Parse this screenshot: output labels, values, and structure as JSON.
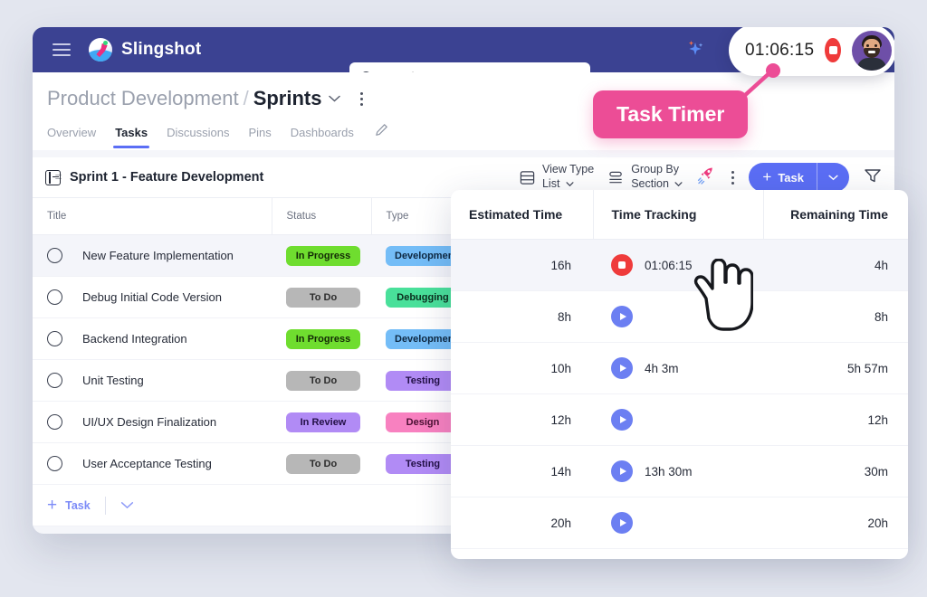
{
  "app": {
    "brand": "Slingshot",
    "menu_icon": "hamburger-icon",
    "logo_icon": "slingshot-rocket-logo"
  },
  "search": {
    "placeholder": "Search...",
    "value": "",
    "icon": "search-icon"
  },
  "topbar": {
    "ai_icon": "sparkles-icon",
    "notification_icon": "bell-icon",
    "timer_value": "01:06:15",
    "stop_icon": "stop-icon",
    "avatar": "user-avatar"
  },
  "callout": {
    "label": "Task Timer"
  },
  "breadcrumb": {
    "parent": "Product Development",
    "separator": "/",
    "current": "Sprints",
    "caret_icon": "chevron-down-icon",
    "more_icon": "kebab-menu-icon"
  },
  "tabs": [
    {
      "label": "Overview",
      "active": false
    },
    {
      "label": "Tasks",
      "active": true
    },
    {
      "label": "Discussions",
      "active": false
    },
    {
      "label": "Pins",
      "active": false
    },
    {
      "label": "Dashboards",
      "active": false
    }
  ],
  "tabs_edit_icon": "pencil-icon",
  "sprint": {
    "icon": "sprint-panel-icon",
    "title": "Sprint 1 - Feature Development"
  },
  "toolbar": {
    "view_type_label": "View Type",
    "view_type_value": "List",
    "view_type_icon": "list-view-icon",
    "group_by_label": "Group By",
    "group_by_value": "Section",
    "group_by_icon": "group-by-icon",
    "rocket_icon": "rocket-icon",
    "more_icon": "kebab-menu-icon",
    "add_task_label": "Task",
    "add_task_plus": "+",
    "add_task_caret_icon": "chevron-down-icon",
    "filter_icon": "filter-icon"
  },
  "task_table": {
    "columns": [
      "Title",
      "Status",
      "Type"
    ],
    "rows": [
      {
        "title": "New Feature Implementation",
        "status": "In Progress",
        "status_bg": "#6fdd2f",
        "status_fg": "#132a06",
        "type": "Development",
        "type_bg": "#74bdf7",
        "type_fg": "#0d2740",
        "highlight": true
      },
      {
        "title": "Debug Initial Code Version",
        "status": "To Do",
        "status_bg": "#b7b7b7",
        "status_fg": "#2c2c2c",
        "type": "Debugging",
        "type_bg": "#49e09a",
        "type_fg": "#0b2e1d",
        "highlight": false
      },
      {
        "title": "Backend Integration",
        "status": "In Progress",
        "status_bg": "#6fdd2f",
        "status_fg": "#132a06",
        "type": "Development",
        "type_bg": "#74bdf7",
        "type_fg": "#0d2740",
        "highlight": false
      },
      {
        "title": "Unit Testing",
        "status": "To Do",
        "status_bg": "#b7b7b7",
        "status_fg": "#2c2c2c",
        "type": "Testing",
        "type_bg": "#b18bf5",
        "type_fg": "#231046",
        "highlight": false
      },
      {
        "title": "UI/UX Design Finalization",
        "status": "In Review",
        "status_bg": "#b18bf5",
        "status_fg": "#231046",
        "type": "Design",
        "type_bg": "#f881c0",
        "type_fg": "#4a0f32",
        "highlight": false
      },
      {
        "title": "User Acceptance Testing",
        "status": "To Do",
        "status_bg": "#b7b7b7",
        "status_fg": "#2c2c2c",
        "type": "Testing",
        "type_bg": "#b18bf5",
        "type_fg": "#231046",
        "highlight": false
      }
    ],
    "add_row": {
      "plus": "+",
      "label": "Task",
      "caret_icon": "chevron-down-icon"
    }
  },
  "time_panel": {
    "columns": [
      "Estimated Time",
      "Time Tracking",
      "Remaining Time"
    ],
    "rows": [
      {
        "estimated": "16h",
        "tracking_state": "running",
        "tracked": "01:06:15",
        "remaining": "4h",
        "highlight": true
      },
      {
        "estimated": "8h",
        "tracking_state": "idle",
        "tracked": "",
        "remaining": "8h",
        "highlight": false
      },
      {
        "estimated": "10h",
        "tracking_state": "idle",
        "tracked": "4h 3m",
        "remaining": "5h 57m",
        "highlight": false
      },
      {
        "estimated": "12h",
        "tracking_state": "idle",
        "tracked": "",
        "remaining": "12h",
        "highlight": false
      },
      {
        "estimated": "14h",
        "tracking_state": "idle",
        "tracked": "13h 30m",
        "remaining": "30m",
        "highlight": false
      },
      {
        "estimated": "20h",
        "tracking_state": "idle",
        "tracked": "",
        "remaining": "20h",
        "highlight": false
      }
    ],
    "play_icon": "play-icon",
    "stop_icon": "stop-icon"
  },
  "cursor": {
    "icon": "hand-pointer-cursor"
  },
  "colors": {
    "topbar": "#3b4292",
    "accent": "#5b6ef5",
    "callout": "#ec4d96",
    "stop": "#ef3b3b",
    "page_bg": "#e3e6ef"
  }
}
